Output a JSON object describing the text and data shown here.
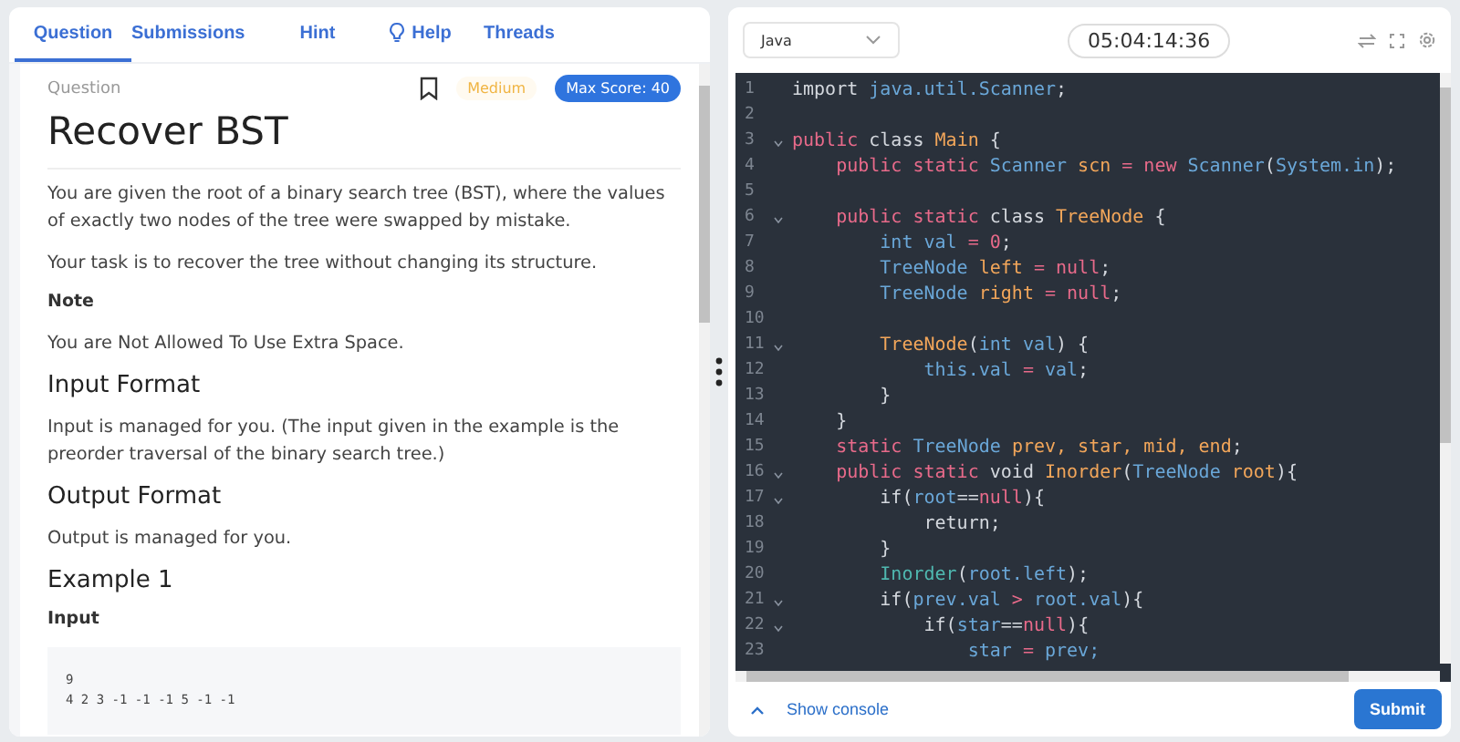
{
  "tabs": [
    {
      "label": "Question",
      "selected": true,
      "icon": false
    },
    {
      "label": "Submissions",
      "selected": false,
      "icon": false
    },
    {
      "label": "Hint",
      "selected": false,
      "icon": false
    },
    {
      "label": "Help",
      "selected": false,
      "icon": true
    },
    {
      "label": "Threads",
      "selected": false,
      "icon": false
    }
  ],
  "question": {
    "label": "Question",
    "bookmarked": false,
    "difficulty": "Medium",
    "max_score": "Max Score: 40",
    "title": "Recover BST",
    "blocks": [
      {
        "kind": "para",
        "text": "You are given the root of a binary search tree (BST), where the values of exactly two nodes of the tree were swapped by mistake."
      },
      {
        "kind": "para",
        "text": "Your task is to recover the tree without changing its structure."
      },
      {
        "kind": "label",
        "text": "Note"
      },
      {
        "kind": "para",
        "text": "You are Not Allowed To Use Extra Space."
      },
      {
        "kind": "heading",
        "text": "Input Format"
      },
      {
        "kind": "para",
        "text": "Input is managed for you. (The input given in the example is the preorder traversal of the binary search tree.)"
      },
      {
        "kind": "heading",
        "text": "Output Format"
      },
      {
        "kind": "para",
        "text": "Output is managed for you."
      },
      {
        "kind": "heading",
        "text": "Example 1"
      },
      {
        "kind": "label",
        "text": "Input"
      },
      {
        "kind": "code",
        "lines": [
          "9",
          "4 2 3 -1 -1 -1 5 -1 -1"
        ]
      }
    ]
  },
  "editor": {
    "language": "Java",
    "timer": "05:04:14:36",
    "lines": [
      {
        "n": "1",
        "fold": false,
        "tokens": [
          {
            "kind": "plain",
            "text": "import "
          },
          {
            "kind": "type",
            "text": "java.util.Scanner"
          },
          {
            "kind": "plain",
            "text": ";"
          }
        ]
      },
      {
        "n": "2",
        "fold": false
      },
      {
        "n": "3",
        "fold": true,
        "tokens": [
          {
            "kind": "kw",
            "text": "public"
          },
          {
            "kind": "plain",
            "text": " class "
          },
          {
            "kind": "name",
            "text": "Main"
          },
          {
            "kind": "plain",
            "text": " {"
          }
        ]
      },
      {
        "n": "4",
        "fold": false,
        "tokens": [
          {
            "kind": "kw",
            "text": "    public static"
          },
          {
            "kind": "type",
            "text": " Scanner "
          },
          {
            "kind": "name",
            "text": "scn"
          },
          {
            "kind": "kw",
            "text": " = new"
          },
          {
            "kind": "type",
            "text": " Scanner"
          },
          {
            "kind": "plain",
            "text": "("
          },
          {
            "kind": "type",
            "text": "System.in"
          },
          {
            "kind": "plain",
            "text": ");"
          }
        ]
      },
      {
        "n": "5",
        "fold": false
      },
      {
        "n": "6",
        "fold": true,
        "tokens": [
          {
            "kind": "kw",
            "text": "    public static"
          },
          {
            "kind": "plain",
            "text": " class "
          },
          {
            "kind": "name",
            "text": "TreeNode"
          },
          {
            "kind": "plain",
            "text": " {"
          }
        ]
      },
      {
        "n": "7",
        "fold": false,
        "tokens": [
          {
            "kind": "type",
            "text": "        int val"
          },
          {
            "kind": "kw",
            "text": " = 0"
          },
          {
            "kind": "plain",
            "text": ";"
          }
        ]
      },
      {
        "n": "8",
        "fold": false,
        "tokens": [
          {
            "kind": "type",
            "text": "        TreeNode "
          },
          {
            "kind": "name",
            "text": "left"
          },
          {
            "kind": "kw",
            "text": " = null"
          },
          {
            "kind": "plain",
            "text": ";"
          }
        ]
      },
      {
        "n": "9",
        "fold": false,
        "tokens": [
          {
            "kind": "type",
            "text": "        TreeNode "
          },
          {
            "kind": "name",
            "text": "right"
          },
          {
            "kind": "kw",
            "text": " = null"
          },
          {
            "kind": "plain",
            "text": ";"
          }
        ]
      },
      {
        "n": "10",
        "fold": false
      },
      {
        "n": "11",
        "fold": true,
        "tokens": [
          {
            "kind": "name",
            "text": "        TreeNode"
          },
          {
            "kind": "plain",
            "text": "("
          },
          {
            "kind": "type",
            "text": "int val"
          },
          {
            "kind": "plain",
            "text": ") {"
          }
        ]
      },
      {
        "n": "12",
        "fold": false,
        "tokens": [
          {
            "kind": "type",
            "text": "            this.val"
          },
          {
            "kind": "kw",
            "text": " = "
          },
          {
            "kind": "type",
            "text": "val"
          },
          {
            "kind": "plain",
            "text": ";"
          }
        ]
      },
      {
        "n": "13",
        "fold": false,
        "tokens": [
          {
            "kind": "plain",
            "text": "        }"
          }
        ]
      },
      {
        "n": "14",
        "fold": false,
        "tokens": [
          {
            "kind": "plain",
            "text": "    }"
          }
        ]
      },
      {
        "n": "15",
        "fold": false,
        "tokens": [
          {
            "kind": "kw",
            "text": "    static"
          },
          {
            "kind": "type",
            "text": " TreeNode "
          },
          {
            "kind": "name",
            "text": "prev, star, mid, end"
          },
          {
            "kind": "plain",
            "text": ";"
          }
        ]
      },
      {
        "n": "16",
        "fold": true,
        "tokens": [
          {
            "kind": "kw",
            "text": "    public static"
          },
          {
            "kind": "plain",
            "text": " void "
          },
          {
            "kind": "name",
            "text": "Inorder"
          },
          {
            "kind": "plain",
            "text": "("
          },
          {
            "kind": "type",
            "text": "TreeNode"
          },
          {
            "kind": "name",
            "text": " root"
          },
          {
            "kind": "plain",
            "text": "){"
          }
        ]
      },
      {
        "n": "17",
        "fold": true,
        "tokens": [
          {
            "kind": "plain",
            "text": "        if("
          },
          {
            "kind": "type",
            "text": "root"
          },
          {
            "kind": "plain",
            "text": "=="
          },
          {
            "kind": "kw",
            "text": "null"
          },
          {
            "kind": "plain",
            "text": "){"
          }
        ]
      },
      {
        "n": "18",
        "fold": false,
        "tokens": [
          {
            "kind": "plain",
            "text": "            return;"
          }
        ]
      },
      {
        "n": "19",
        "fold": false,
        "tokens": [
          {
            "kind": "plain",
            "text": "        }"
          }
        ]
      },
      {
        "n": "20",
        "fold": false,
        "tokens": [
          {
            "kind": "call",
            "text": "        Inorder"
          },
          {
            "kind": "plain",
            "text": "("
          },
          {
            "kind": "type",
            "text": "root.left"
          },
          {
            "kind": "plain",
            "text": ");"
          }
        ]
      },
      {
        "n": "21",
        "fold": true,
        "tokens": [
          {
            "kind": "plain",
            "text": "        if("
          },
          {
            "kind": "type",
            "text": "prev.val"
          },
          {
            "kind": "kw",
            "text": " > "
          },
          {
            "kind": "type",
            "text": "root.val"
          },
          {
            "kind": "plain",
            "text": "){"
          }
        ]
      },
      {
        "n": "22",
        "fold": true,
        "tokens": [
          {
            "kind": "plain",
            "text": "            if("
          },
          {
            "kind": "type",
            "text": "star"
          },
          {
            "kind": "plain",
            "text": "=="
          },
          {
            "kind": "kw",
            "text": "null"
          },
          {
            "kind": "plain",
            "text": "){"
          }
        ]
      },
      {
        "n": "23",
        "fold": false,
        "tokens": [
          {
            "kind": "type",
            "text": "                star"
          },
          {
            "kind": "kw",
            "text": " = "
          },
          {
            "kind": "type",
            "text": "prev;"
          }
        ]
      }
    ]
  },
  "footer": {
    "console_label": "Show console",
    "submit": "Submit"
  }
}
